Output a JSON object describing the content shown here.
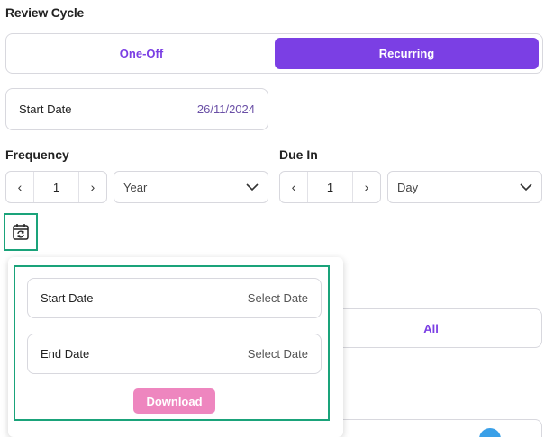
{
  "review_cycle": {
    "title": "Review Cycle",
    "options": [
      "One-Off",
      "Recurring"
    ],
    "selected": "Recurring",
    "accent_color": "#7b3fe4"
  },
  "start_date": {
    "label": "Start Date",
    "value": "26/11/2024"
  },
  "frequency": {
    "label": "Frequency",
    "value": "1",
    "decrement": "‹",
    "increment": "›",
    "unit": "Year"
  },
  "due_in": {
    "label": "Due In",
    "value": "1",
    "decrement": "‹",
    "increment": "›",
    "unit": "Day"
  },
  "calendar_button": {
    "icon": "calendar-repeat-icon",
    "highlight_color": "#1aa37a"
  },
  "background": {
    "all_button": "All"
  },
  "date_popup": {
    "start_label": "Start Date",
    "start_placeholder": "Select Date",
    "end_label": "End Date",
    "end_placeholder": "Select Date",
    "download_label": "Download",
    "download_color": "#ee86bf"
  }
}
